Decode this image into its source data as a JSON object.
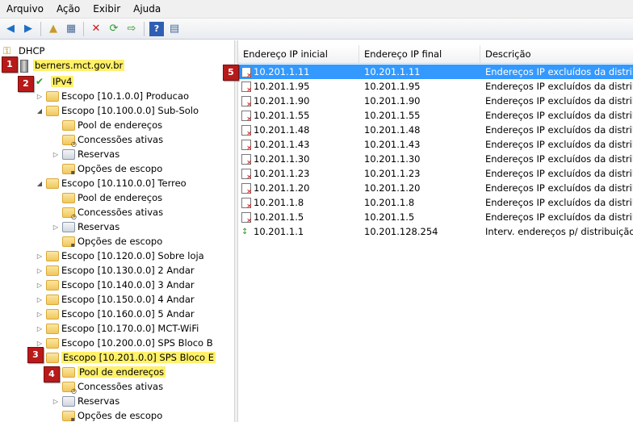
{
  "menu": [
    "Arquivo",
    "Ação",
    "Exibir",
    "Ajuda"
  ],
  "toolbar_icons": [
    "back-icon",
    "forward-icon",
    "up-folder-icon",
    "show-hide-tree-icon",
    "delete-icon",
    "refresh-icon",
    "export-icon",
    "help-icon",
    "console-tree-icon"
  ],
  "tree": {
    "root": "DHCP",
    "server": "berners.mct.gov.br",
    "ipv4": "IPv4",
    "items": [
      {
        "label": "Escopo [10.1.0.0] Producao"
      },
      {
        "label": "Escopo [10.100.0.0] Sub-Solo"
      },
      {
        "label": "Pool de endereços"
      },
      {
        "label": "Concessões ativas"
      },
      {
        "label": "Reservas"
      },
      {
        "label": "Opções de escopo"
      },
      {
        "label": "Escopo [10.110.0.0] Terreo"
      },
      {
        "label": "Pool de endereços"
      },
      {
        "label": "Concessões ativas"
      },
      {
        "label": "Reservas"
      },
      {
        "label": "Opções de escopo"
      },
      {
        "label": "Escopo [10.120.0.0] Sobre loja"
      },
      {
        "label": "Escopo [10.130.0.0] 2 Andar"
      },
      {
        "label": "Escopo [10.140.0.0] 3 Andar"
      },
      {
        "label": "Escopo [10.150.0.0] 4 Andar"
      },
      {
        "label": "Escopo [10.160.0.0] 5 Andar"
      },
      {
        "label": "Escopo [10.170.0.0] MCT-WiFi"
      },
      {
        "label": "Escopo [10.200.0.0] SPS Bloco B"
      },
      {
        "label": "Escopo [10.201.0.0] SPS Bloco E"
      },
      {
        "label": "Pool de endereços"
      },
      {
        "label": "Concessões ativas"
      },
      {
        "label": "Reservas"
      },
      {
        "label": "Opções de escopo"
      }
    ]
  },
  "badges": [
    "1",
    "2",
    "3",
    "4",
    "5"
  ],
  "columns": [
    "Endereço IP inicial",
    "Endereço IP final",
    "Descrição"
  ],
  "rows": [
    {
      "start": "10.201.1.11",
      "end": "10.201.1.11",
      "desc": "Endereços IP excluídos da distrib."
    },
    {
      "start": "10.201.1.95",
      "end": "10.201.1.95",
      "desc": "Endereços IP excluídos da distrib."
    },
    {
      "start": "10.201.1.90",
      "end": "10.201.1.90",
      "desc": "Endereços IP excluídos da distrib."
    },
    {
      "start": "10.201.1.55",
      "end": "10.201.1.55",
      "desc": "Endereços IP excluídos da distrib."
    },
    {
      "start": "10.201.1.48",
      "end": "10.201.1.48",
      "desc": "Endereços IP excluídos da distrib."
    },
    {
      "start": "10.201.1.43",
      "end": "10.201.1.43",
      "desc": "Endereços IP excluídos da distrib."
    },
    {
      "start": "10.201.1.30",
      "end": "10.201.1.30",
      "desc": "Endereços IP excluídos da distrib."
    },
    {
      "start": "10.201.1.23",
      "end": "10.201.1.23",
      "desc": "Endereços IP excluídos da distrib."
    },
    {
      "start": "10.201.1.20",
      "end": "10.201.1.20",
      "desc": "Endereços IP excluídos da distrib."
    },
    {
      "start": "10.201.1.8",
      "end": "10.201.1.8",
      "desc": "Endereços IP excluídos da distrib."
    },
    {
      "start": "10.201.1.5",
      "end": "10.201.1.5",
      "desc": "Endereços IP excluídos da distrib."
    },
    {
      "start": "10.201.1.1",
      "end": "10.201.128.254",
      "desc": "Interv. endereços p/ distribuição"
    }
  ],
  "colors": {
    "highlight": "#fff16a",
    "badge": "#b81a1a",
    "selection": "#3399ff"
  }
}
